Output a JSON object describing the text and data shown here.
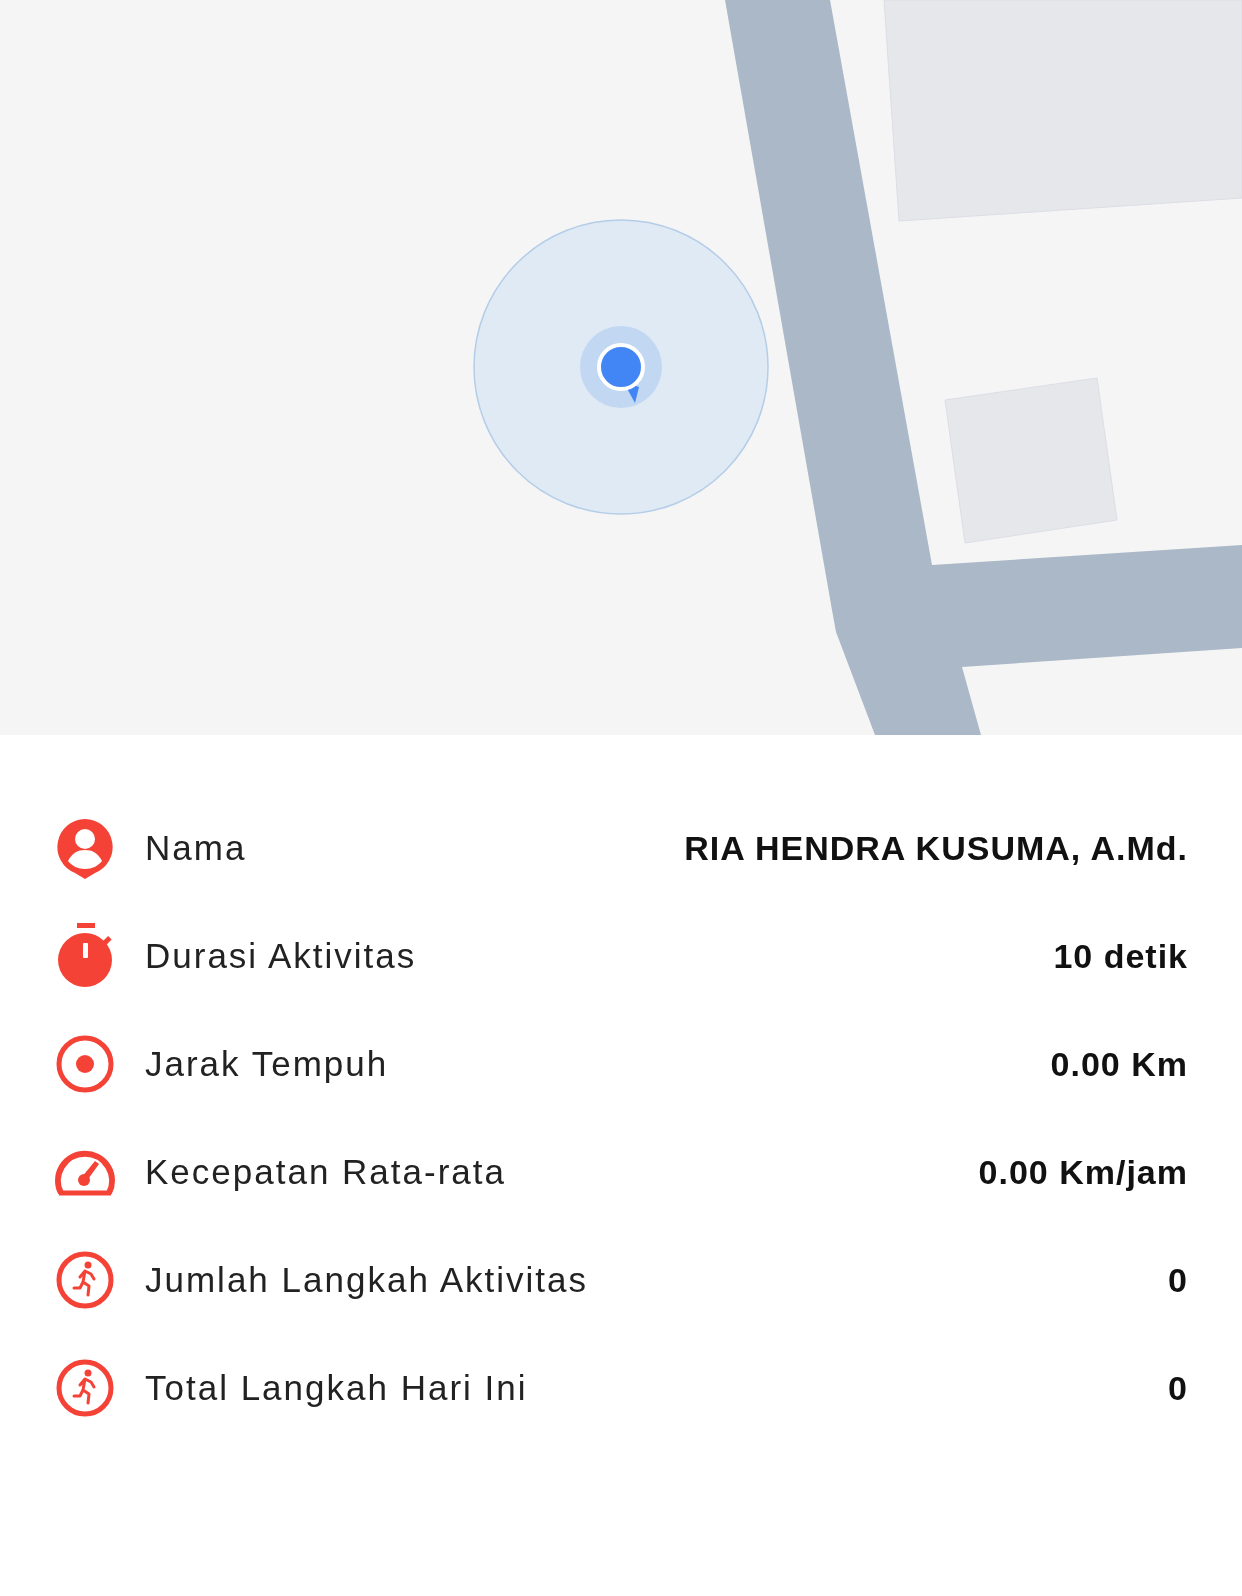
{
  "stats": [
    {
      "kind": "person",
      "label": "Nama",
      "value": "RIA HENDRA KUSUMA, A.Md."
    },
    {
      "kind": "duration",
      "label": "Durasi Aktivitas",
      "value": "10 detik"
    },
    {
      "kind": "distance",
      "label": "Jarak Tempuh",
      "value": "0.00 Km"
    },
    {
      "kind": "speed",
      "label": "Kecepatan Rata-rata",
      "value": "0.00 Km/jam"
    },
    {
      "kind": "steps",
      "label": "Jumlah Langkah Aktivitas",
      "value": "0"
    },
    {
      "kind": "steps",
      "label": "Total Langkah Hari Ini",
      "value": "0"
    }
  ]
}
